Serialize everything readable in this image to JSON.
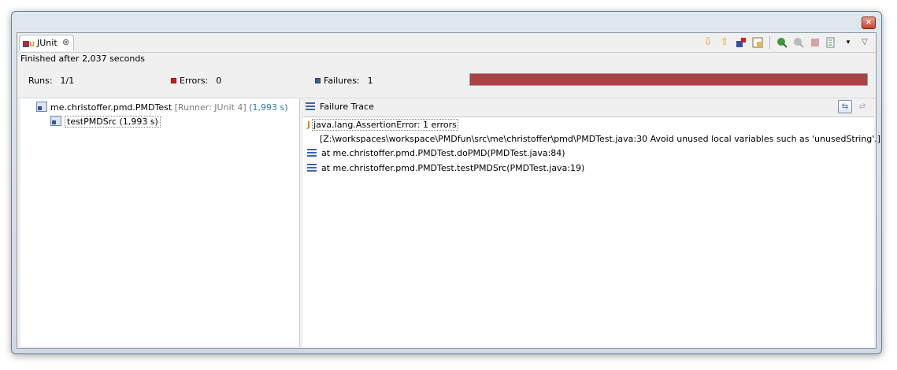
{
  "window": {
    "close_label": "×"
  },
  "tab": {
    "label": "JUnit",
    "close": "⊗"
  },
  "toolbar": {
    "icons": [
      "next-failure-icon",
      "previous-failure-icon",
      "show-failures-only-icon",
      "scroll-lock-icon",
      "rerun-icon",
      "rerun-failed-first-icon",
      "stop-icon",
      "history-icon",
      "dropdown-icon",
      "view-menu-icon"
    ]
  },
  "status": {
    "text": "Finished after 2,037 seconds"
  },
  "counters": {
    "runs_label": "Runs:",
    "runs_value": "1/1",
    "errors_label": "Errors:",
    "errors_value": "0",
    "failures_label": "Failures:",
    "failures_value": "1"
  },
  "progress": {
    "fraction": 1.0,
    "color": "#a94442"
  },
  "tree": {
    "root": {
      "name": "me.christoffer.pmd.PMDTest",
      "runner": "[Runner: JUnit 4]",
      "duration": "(1,993 s)"
    },
    "child": {
      "name": "testPMDSrc",
      "duration": "(1,993 s)"
    }
  },
  "trace": {
    "title": "Failure Trace",
    "lines": [
      "java.lang.AssertionError: 1 errors",
      "[Z:\\workspaces\\workspace\\PMDfun\\src\\me\\christoffer\\pmd\\PMDTest.java:30 Avoid unused local variables such as 'unusedString'.]",
      "at me.christoffer.pmd.PMDTest.doPMD(PMDTest.java:84)",
      "at me.christoffer.pmd.PMDTest.testPMDSrc(PMDTest.java:19)"
    ]
  }
}
